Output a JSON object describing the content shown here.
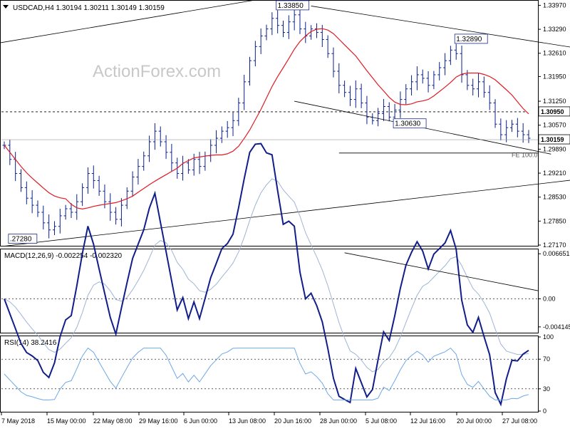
{
  "header": {
    "title": "USDCAD,H4  1.30194 1.30211 1.30149 1.30159"
  },
  "watermark": "ActionForex.com",
  "colors": {
    "price_bars": "#0b1f8c",
    "ma": "#e01b24",
    "trendline": "#000000",
    "macd_line": "#111e8a",
    "macd_signal": "#9fb4d6",
    "rsi_line": "#6ea8e6",
    "grid": "#000000",
    "watermark": "#c8c8c8"
  },
  "price_levels": {
    "upper_dashed": "1.30950",
    "lower_line": "FE 100.0"
  },
  "chart_data": [
    {
      "type": "candlestick",
      "title": "USDCAD,H4  1.30194 1.30211 1.30149 1.30159",
      "ylim": [
        1.2715,
        1.341
      ],
      "y_ticks": [
        "1.33970",
        "1.33290",
        "1.32610",
        "1.31950",
        "1.31250",
        "1.30570",
        "1.29890",
        "1.29210",
        "1.28530",
        "1.27850",
        "1.27170"
      ],
      "x_ticks": [
        "7 May 2018",
        "15 May 00:00",
        "22 May 08:00",
        "29 May 16:00",
        "6 Jun 00:00",
        "13 Jun 08:00",
        "20 Jun 16:00",
        "28 Jun 00:00",
        "5 Jul 08:00",
        "12 Jul 16:00",
        "20 Jul 00:00",
        "27 Jul 08:00"
      ],
      "price_labels": [
        "1.30950",
        "1.30159"
      ],
      "annotations": [
        {
          "label": "1.33850",
          "value": 1.3385
        },
        {
          "label": "1.32890",
          "value": 1.3289
        },
        {
          "label": "1.30630",
          "value": 1.3063
        },
        {
          "label": ".27280",
          "value": 1.2728
        },
        {
          "label": "FE 100.0",
          "value": 1.298
        }
      ],
      "series_close": [
        1.3,
        1.296,
        1.292,
        1.288,
        1.285,
        1.283,
        1.281,
        1.278,
        1.276,
        1.277,
        1.28,
        1.282,
        1.281,
        1.284,
        1.288,
        1.292,
        1.29,
        1.287,
        1.284,
        1.281,
        1.279,
        1.283,
        1.287,
        1.291,
        1.294,
        1.297,
        1.301,
        1.304,
        1.301,
        1.298,
        1.295,
        1.292,
        1.295,
        1.293,
        1.296,
        1.294,
        1.297,
        1.3,
        1.302,
        1.304,
        1.305,
        1.307,
        1.312,
        1.318,
        1.324,
        1.328,
        1.331,
        1.333,
        1.336,
        1.334,
        1.332,
        1.335,
        1.337,
        1.333,
        1.331,
        1.333,
        1.332,
        1.33,
        1.326,
        1.321,
        1.317,
        1.315,
        1.313,
        1.316,
        1.312,
        1.308,
        1.307,
        1.309,
        1.311,
        1.308,
        1.31,
        1.313,
        1.316,
        1.318,
        1.32,
        1.319,
        1.317,
        1.32,
        1.322,
        1.324,
        1.327,
        1.326,
        1.32,
        1.317,
        1.316,
        1.318,
        1.315,
        1.312,
        1.306,
        1.303,
        1.305,
        1.306,
        1.304,
        1.303,
        1.302
      ]
    },
    {
      "type": "line",
      "title": "MACD(12,26,9) -0.002254 -0.002320",
      "ylim": [
        -0.005,
        0.0072
      ],
      "y_ticks": [
        "0.006651",
        "0.00",
        "-0.004145"
      ]
    },
    {
      "type": "line",
      "title": "RSI(14) 38.2416",
      "ylim": [
        0,
        100
      ],
      "y_ticks": [
        "100",
        "70",
        "30",
        "0"
      ]
    }
  ]
}
